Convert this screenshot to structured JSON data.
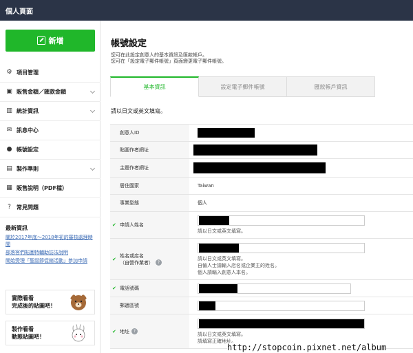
{
  "topbar": {
    "title": "個人頁面"
  },
  "sidebar": {
    "new_button": "新增",
    "items": [
      {
        "label": "項目管理",
        "icon": "gear-icon",
        "chevron": false
      },
      {
        "label": "販售金額／匯款金額",
        "icon": "wallet-icon",
        "chevron": true
      },
      {
        "label": "統計資訊",
        "icon": "chart-icon",
        "chevron": true
      },
      {
        "label": "訊息中心",
        "icon": "mail-icon",
        "chevron": false
      },
      {
        "label": "帳號設定",
        "icon": "user-icon",
        "chevron": false
      },
      {
        "label": "製作準則",
        "icon": "document-icon",
        "chevron": true
      },
      {
        "label": "販售說明（PDF檔）",
        "icon": "pdf-icon",
        "chevron": false
      },
      {
        "label": "常見問題",
        "icon": "question-icon",
        "chevron": false
      }
    ],
    "news": {
      "title": "最新資訊",
      "links": [
        "關於2017年底～2018年初的審核處理時間",
        "部落客們貼圖特輔助訪法說明",
        "開始受理「聖誕節促銷活動」參加申請"
      ]
    },
    "promos": [
      {
        "line1": "實際看看",
        "line2": "完成後的貼圖吧！"
      },
      {
        "line1": "製作看看",
        "line2": "動態貼圖吧！"
      }
    ]
  },
  "main": {
    "title": "帳號設定",
    "desc_line1": "您可在此設定創意人的基本資訊及匯款帳戶。",
    "desc_line2": "您可在「設定電子郵件帳號」頁面變更電子郵件帳號。",
    "tabs": [
      {
        "label": "基本資訊",
        "active": true
      },
      {
        "label": "設定電子郵件帳號",
        "active": false
      },
      {
        "label": "匯款帳戶資訊",
        "active": false
      }
    ],
    "note": "請以日文或英文填寫。",
    "form": {
      "creator_id_label": "創意人ID",
      "sticker_url_label": "貼圖作者網址",
      "theme_url_label": "主題作者網址",
      "country_label": "居住國家",
      "country_value": "Taiwan",
      "business_label": "事業型態",
      "business_value": "個人",
      "applicant_label": "申請人姓名",
      "applicant_hint": "請以日文或英文填寫。",
      "name_label_1": "姓名或店名",
      "name_label_2": "（自營作業者）",
      "name_hint_1": "請以日文或英文填寫。",
      "name_hint_2": "自僱人士請輸入店名或企業主的姓名。",
      "name_hint_3": "個人請輸入創意人本名。",
      "phone_label": "電話號碼",
      "zip_label": "郵遞區號",
      "address_label": "地址",
      "address_hint_1": "請以日文或英文填寫。",
      "address_hint_2": "請填寫正確地址。"
    }
  },
  "watermark": "http://stopcoin.pixnet.net/album",
  "colors": {
    "accent": "#20b72a",
    "topbar": "#2b3447",
    "link": "#3b6bb5"
  }
}
